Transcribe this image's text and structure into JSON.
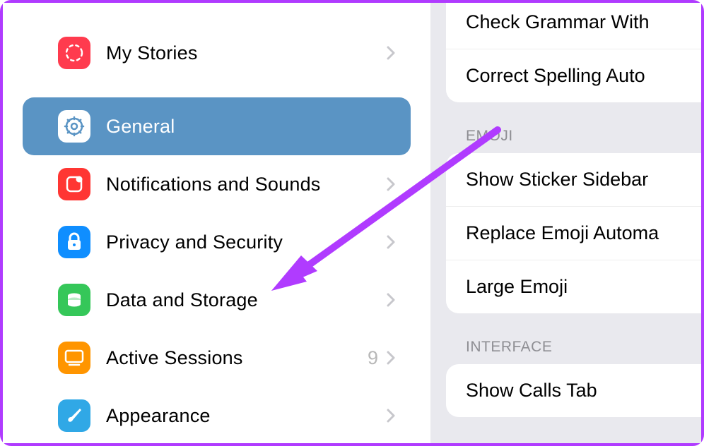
{
  "sidebar": {
    "items": [
      {
        "label": "My Stories",
        "icon_color": "#ff3b4e",
        "badge": ""
      },
      {
        "label": "General",
        "icon_color": "#ffffff",
        "badge": "",
        "active": true
      },
      {
        "label": "Notifications and Sounds",
        "icon_color": "#ff3633",
        "badge": ""
      },
      {
        "label": "Privacy and Security",
        "icon_color": "#0f8eff",
        "badge": ""
      },
      {
        "label": "Data and Storage",
        "icon_color": "#35c759",
        "badge": ""
      },
      {
        "label": "Active Sessions",
        "icon_color": "#ff9500",
        "badge": "9"
      },
      {
        "label": "Appearance",
        "icon_color": "#30a8e6",
        "badge": ""
      }
    ]
  },
  "panel": {
    "spelling": [
      "Check Grammar With",
      "Correct Spelling Auto"
    ],
    "emoji_header": "EMOJI",
    "emoji_rows": [
      "Show Sticker Sidebar",
      "Replace Emoji Automa",
      "Large Emoji"
    ],
    "interface_header": "INTERFACE",
    "interface_rows": [
      "Show Calls Tab"
    ]
  }
}
